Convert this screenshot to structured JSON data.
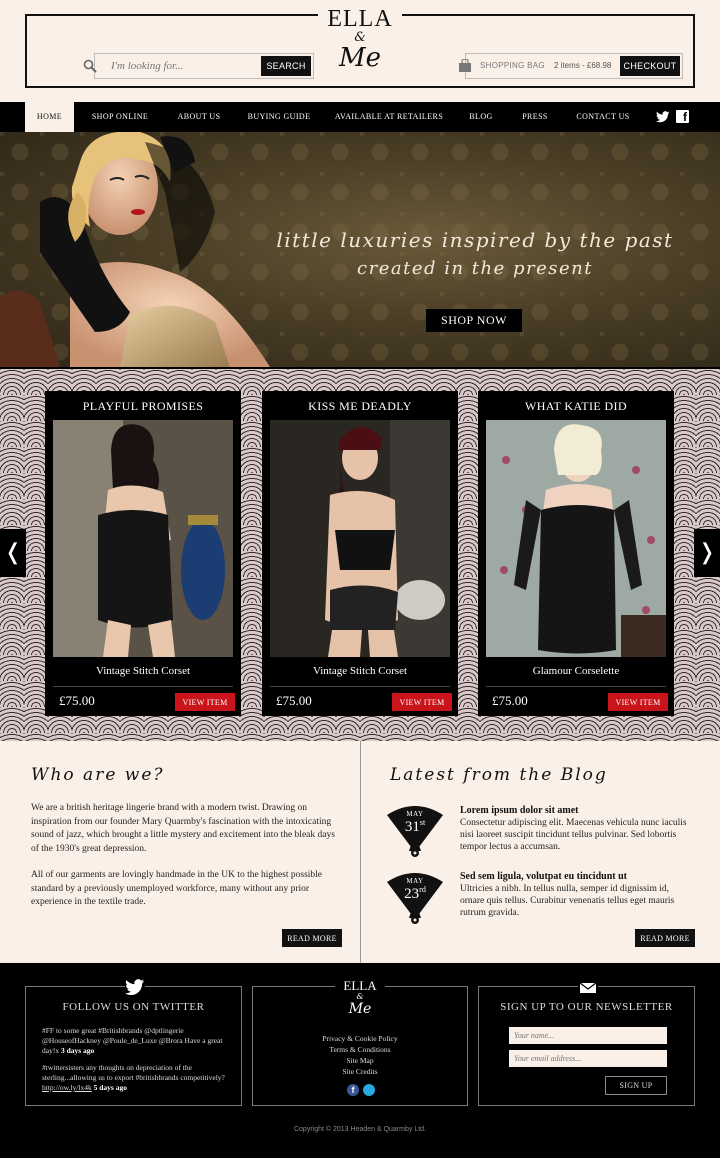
{
  "brand": {
    "line1": "ELLA",
    "line2": "&",
    "line3": "Me"
  },
  "header": {
    "search_placeholder": "I'm looking for...",
    "search_label": "SEARCH",
    "bag_label": "SHOPPING BAG",
    "bag_count": "2 items - £68.98",
    "checkout_label": "CHECKOUT"
  },
  "nav": {
    "items": [
      {
        "label": "HOME"
      },
      {
        "label": "SHOP ONLINE"
      },
      {
        "label": "ABOUT US"
      },
      {
        "label": "BUYING GUIDE"
      },
      {
        "label": "AVAILABLE AT RETAILERS"
      },
      {
        "label": "BLOG"
      },
      {
        "label": "PRESS"
      },
      {
        "label": "CONTACT US"
      }
    ],
    "social_icons": [
      "twitter-icon",
      "facebook-icon"
    ]
  },
  "hero": {
    "tagline1": "little luxuries inspired by the past",
    "tagline2": "created in the present",
    "cta": "SHOP NOW"
  },
  "products": [
    {
      "collection": "PLAYFUL PROMISES",
      "name": "Vintage Stitch Corset",
      "price": "£75.00",
      "button": "VIEW ITEM"
    },
    {
      "collection": "KISS ME DEADLY",
      "name": "Vintage Stitch Corset",
      "price": "£75.00",
      "button": "VIEW ITEM"
    },
    {
      "collection": "WHAT KATIE DID",
      "name": "Glamour Corselette",
      "price": "£75.00",
      "button": "VIEW ITEM"
    }
  ],
  "carousel": {
    "prev": "❬",
    "next": "❭"
  },
  "who": {
    "heading": "Who are we?",
    "para1": "We are a british heritage lingerie brand with a modern twist. Drawing on inspiration from our founder Mary Quarmby's fascination with the intoxicating sound of jazz, which brought a little mystery and excitement into the bleak days of the 1930's great depression.",
    "para2": "All of our garments are lovingly handmade in the UK to the highest possible standard by a previously unemployed workforce, many without any prior experience in the textile trade.",
    "read_more": "READ MORE"
  },
  "blog": {
    "heading": "Latest from the Blog",
    "posts": [
      {
        "month": "MAY",
        "day": "31",
        "suffix": "st",
        "title": "Lorem ipsum dolor sit amet",
        "text": "Consectetur adipiscing elit. Maecenas vehicula nunc iaculis nisi laoreet suscipit tincidunt tellus pulvinar. Sed lobortis tempor lectus a accumsan."
      },
      {
        "month": "MAY",
        "day": "23",
        "suffix": "rd",
        "title": "Sed sem ligula, volutpat eu tincidunt ut",
        "text": "Ultricies a nibh. In tellus nulla, semper id dignissim id, ornare quis tellus. Curabitur venenatis tellus eget mauris rutrum gravida."
      }
    ],
    "read_more": "READ MORE"
  },
  "footer": {
    "twitter_heading": "FOLLOW US ON TWITTER",
    "tweet1_text": "#FF to some great #Britishbrands @dptlingerie @HouseofHackney @Poule_de_Luxe @Brora Have a great day!x",
    "tweet1_time": "3 days ago",
    "tweet2_text": "#twittersisters any thoughts on depreciation of the sterling...allowing us to export #britishbrands competitively?",
    "tweet2_link": "http://ow.ly/lx4k",
    "tweet2_time": "5 days ago",
    "links": [
      "Privacy & Cookie Policy",
      "Terms & Conditions",
      "Site Map",
      "Site Credits"
    ],
    "newsletter_heading": "SIGN UP TO OUR NEWSLETTER",
    "name_placeholder": "Your name...",
    "email_placeholder": "Your email address...",
    "signup_label": "SIGN UP",
    "copyright": "Copyright © 2013 Headen & Quarmby Ltd."
  },
  "colors": {
    "cream": "#fbf0e8",
    "black": "#000000",
    "accent_red": "#c8141a"
  }
}
